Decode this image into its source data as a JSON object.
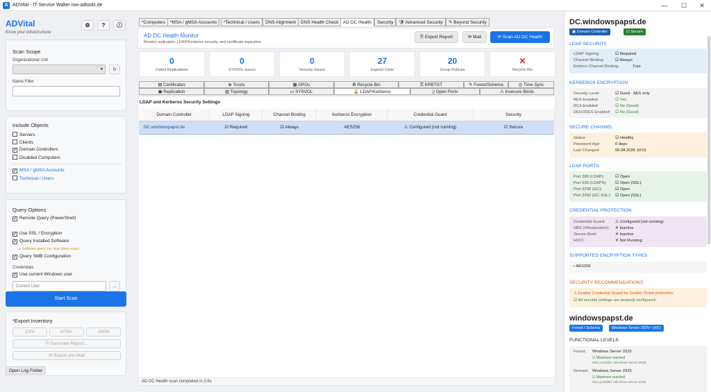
{
  "window": {
    "title": "ADVital - IT-Service Walter isw-adtools.de",
    "min": "—",
    "max": "☐",
    "close": "✕"
  },
  "sidebar": {
    "brand": "ADVital",
    "brand_sub": "Know your infrastructure",
    "scope": {
      "title": "Scan Scope",
      "ou_label": "Organizational Unit",
      "name_filter_label": "Name Filter"
    },
    "include": {
      "title": "Include Objects",
      "items": [
        {
          "label": "Servers",
          "checked": false
        },
        {
          "label": "Clients",
          "checked": false
        },
        {
          "label": "Domain Controllers",
          "checked": true
        },
        {
          "label": "Disabled Computers",
          "checked": false
        }
      ],
      "msa": "MSA / gMSA Accounts",
      "tech": "Technical / Users"
    },
    "query": {
      "title": "Query Options",
      "remote": "Remote Query (PowerShell)",
      "ssl": "Use SSL / Encryption",
      "software": "Query Installed Software",
      "warning": "Software query can slow down scans",
      "smb": "Query SMB Configuration",
      "cred_label": "Credentials",
      "current_user_cb": "Use current Windows user",
      "current_user_placeholder": "Current User",
      "browse": "..."
    },
    "start": "Start Scan",
    "export": {
      "title": "*Export Inventory",
      "csv": "CSV",
      "html": "HTML",
      "json": "JSON",
      "report": "Generate Report...",
      "mail": "Report per Mail"
    },
    "log": "Open Log Folder"
  },
  "tabs": [
    "*Computers",
    "*MSA / gMSA Accounts",
    "*Technical / Users",
    "DNS Alignment",
    "DNS Health Check",
    "AD DC Health",
    "Security",
    "Advanced Security",
    "Beyond Security"
  ],
  "header": {
    "title": "AD DC Health Monitor",
    "subtitle": "Monitor replication, LDAP/Kerberos security, and certificate expiration",
    "export": "Export Report",
    "mail": "Mail",
    "scan": "Scan AD DC Health"
  },
  "stats": [
    {
      "n": "0",
      "l": "Failed Replications"
    },
    {
      "n": "0",
      "l": "SYSVOL Issues"
    },
    {
      "n": "0",
      "l": "Security Issues"
    },
    {
      "n": "27",
      "l": "Expired Certs"
    },
    {
      "n": "20",
      "l": "Group Policies"
    },
    {
      "n": "✕",
      "l": "Recycle Bin"
    }
  ],
  "subtabs_row1": [
    "Certificates",
    "Trusts",
    "GPOs",
    "Recycle Bin",
    "KRBTGT",
    "Forest/Schema",
    "Time Sync"
  ],
  "subtabs_row2": [
    "Replication",
    "Topology",
    "SYSVOL",
    "LDAP/Kerberos",
    "Open Ports",
    "Insecure Binds"
  ],
  "section_title": "LDAP and Kerberos Security Settings",
  "grid": {
    "headers": [
      "Domain Controller",
      "LDAP Signing",
      "Channel Binding",
      "Kerberos Encryption",
      "Credential Guard",
      "Security"
    ],
    "row": [
      "DC.windowspapst.de",
      "Required",
      "Always",
      "AES256",
      "Configured (not running)",
      "Secure"
    ]
  },
  "status": "AD DC Health scan completed in 2.6s",
  "detail": {
    "dc": "DC.windowspapst.de",
    "chip1": "Domain Controller",
    "chip2": "Secure",
    "ldap": {
      "title": "LDAP SECURITY",
      "k1": "LDAP Signing:",
      "v1": "Required",
      "k2": "Channel Binding:",
      "v2": "Always",
      "k3": "Enforce Channel Binding:",
      "v3": "True"
    },
    "kerb": {
      "title": "KERBEROS ENCRYPTION",
      "k1": "Security Level:",
      "v1": "Good - AES only",
      "k2": "AES Enabled:",
      "v2": "Yes",
      "k3": "RC4 Enabled:",
      "v3": "No (Good)",
      "k4": "DES/3DES Enabled:",
      "v4": "No (Good)"
    },
    "chan": {
      "title": "SECURE CHANNEL",
      "k1": "Status:",
      "v1": "Healthy",
      "k2": "Password Age:",
      "v2": "0 days",
      "k3": "Last Changed:",
      "v3": "06.08.2026 10:01"
    },
    "ports": {
      "title": "LDAP PORTS",
      "k1": "Port 389 (LDAP):",
      "v1": "Open",
      "k2": "Port 636 (LDAPS):",
      "v2": "Open (SSL)",
      "k3": "Port 3268 (GC):",
      "v3": "Open",
      "k4": "Port 3269 (GC-SSL):",
      "v4": "Open (SSL)"
    },
    "cred": {
      "title": "CREDENTIAL PROTECTION",
      "k1": "Credential Guard:",
      "v1": "Configured (not running)",
      "k2": "VBS (Virtualization):",
      "v2": "Inactive",
      "k3": "Secure Boot:",
      "v3": "Inactive",
      "k4": "HVCI:",
      "v4": "Not Running"
    },
    "enc": {
      "title": "SUPPORTED ENCRYPTION TYPES",
      "v": "AES256"
    },
    "rec": {
      "title": "SECURITY RECOMMENDATIONS",
      "r1": "Enable Credential Guard for Golden Ticket protection",
      "r2": "All security settings are properly configured!"
    },
    "domain": "windowspapst.de",
    "dchip1": "Forest / Schema",
    "dchip2": "Windows Server 2025+ (v91)",
    "func": {
      "title": "FUNCTIONAL LEVELS",
      "forest_k": "Forest:",
      "forest_v": "Windows Server 2025",
      "max1": "Maximum reached",
      "poss1": "Max possible: Windows Server 2025",
      "domain_k": "Domain:",
      "domain_v": "Windows Server 2025",
      "max2": "Maximum reached",
      "poss2": "Max possible: Windows Server 2025"
    }
  }
}
